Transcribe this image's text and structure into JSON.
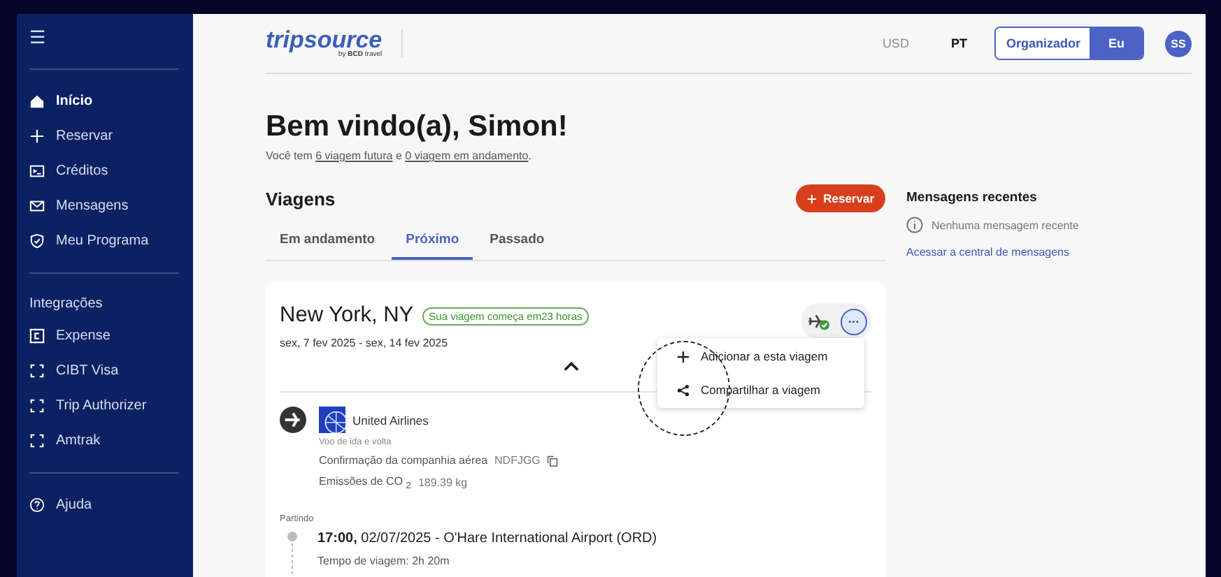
{
  "sidebar": {
    "menu_icon": "☰",
    "items": [
      {
        "label": "Início",
        "selected": true
      },
      {
        "label": "Reservar",
        "selected": false
      },
      {
        "label": "Créditos",
        "selected": false
      },
      {
        "label": "Mensagens",
        "selected": false
      },
      {
        "label": "Meu Programa",
        "selected": false
      }
    ],
    "integrations_title": "Integrações",
    "integrations": [
      {
        "label": "Expense"
      },
      {
        "label": "CIBT Visa"
      },
      {
        "label": "Trip Authorizer"
      },
      {
        "label": "Amtrak"
      }
    ],
    "help": {
      "label": "Ajuda"
    }
  },
  "header": {
    "logo": {
      "name": "tripsource",
      "by": "by",
      "brand": "BCD",
      "suffix": "travel"
    },
    "currency": {
      "label": "USD",
      "disabled": true
    },
    "language": "PT",
    "toggle": [
      {
        "label": "Organizador",
        "selected": false
      },
      {
        "label": "Eu",
        "selected": true
      }
    ],
    "avatar": "SS"
  },
  "welcome": {
    "title": "Bem vindo(a), Simon!",
    "prefix": "Você tem",
    "link1": "6 viagem futura",
    "middle": "e",
    "link2": "0 viagem em andamento",
    "suffix": "."
  },
  "trips": {
    "title": "Viagens",
    "book_button": "Reservar",
    "tabs": [
      {
        "label": "Em andamento",
        "selected": false
      },
      {
        "label": "Próximo",
        "selected": true
      },
      {
        "label": "Passado",
        "selected": false
      }
    ],
    "card": {
      "city": "New York, NY",
      "badge": "Sua viagem começa em23 horas",
      "dates": "sex, 7 fev 2025 - sex, 14 fev 2025",
      "more_button": "···",
      "menu": [
        {
          "label": "Adicionar a esta viagem"
        },
        {
          "label": "Compartilhar a viagem"
        }
      ],
      "flight": {
        "airline": "United Airlines",
        "trip_type": "Voo de ida e volta",
        "confirmation_label": "Confirmação da companhia aérea",
        "confirmation": "NDFJGG",
        "emissions_label": "Emissões de CO $_{2}$",
        "emissions": "189.39 kg",
        "departing_label": "Partindo",
        "departure": "**17:00,** 02/07/2025 - O'Hare International Airport (ORD)",
        "duration": "Tempo de viagem: 2h 20m"
      }
    }
  },
  "messages": {
    "title": "Mensagens recentes",
    "empty": "Nenhuma mensagem recente",
    "link": "Acessar a central de mensagens"
  }
}
